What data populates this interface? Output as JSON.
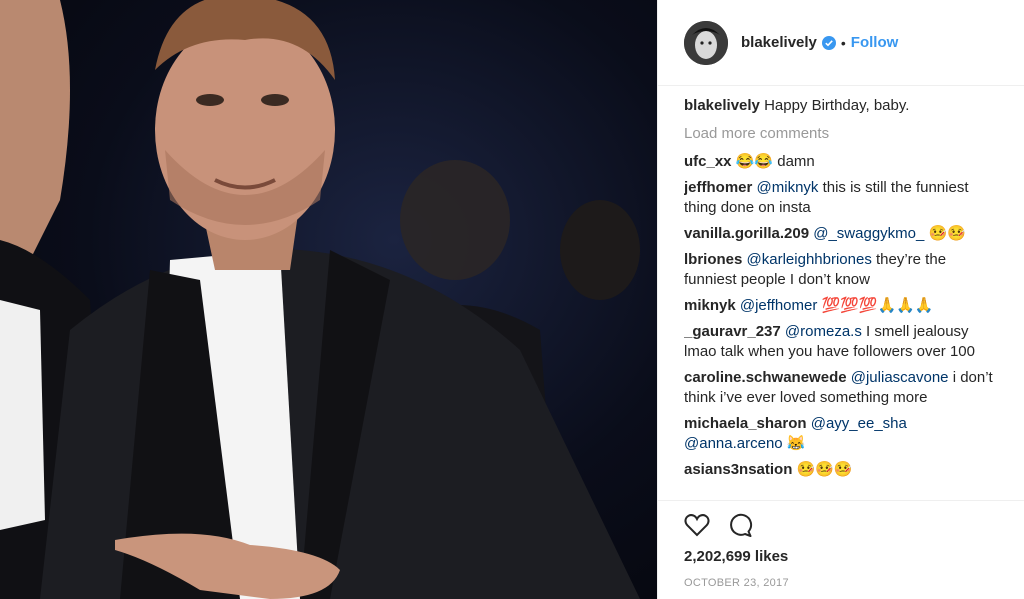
{
  "post": {
    "username": "blakelively",
    "verified": true,
    "separator": "•",
    "follow_label": "Follow",
    "caption_user": "blakelively",
    "caption_text": "Happy Birthday, baby.",
    "load_more": "Load more comments",
    "likes": "2,202,699 likes",
    "date": "OCTOBER 23, 2017"
  },
  "comments": [
    {
      "user": "ufc_xx",
      "parts": [
        {
          "t": "😂😂 damn",
          "m": false
        }
      ]
    },
    {
      "user": "jeffhomer",
      "parts": [
        {
          "t": "@miknyk",
          "m": true
        },
        {
          "t": " this is still the funniest thing done on insta",
          "m": false
        }
      ]
    },
    {
      "user": "vanilla.gorilla.209",
      "parts": [
        {
          "t": "@_swaggykmo_",
          "m": true
        },
        {
          "t": " 🤒🤒",
          "m": false
        }
      ]
    },
    {
      "user": "lbriones",
      "parts": [
        {
          "t": "@karleighhbriones",
          "m": true
        },
        {
          "t": " they’re the funniest people I don’t know",
          "m": false
        }
      ]
    },
    {
      "user": "miknyk",
      "parts": [
        {
          "t": "@jeffhomer",
          "m": true
        },
        {
          "t": " 💯💯💯🙏🙏🙏",
          "m": false
        }
      ]
    },
    {
      "user": "_gauravr_237",
      "parts": [
        {
          "t": "@romeza.s",
          "m": true
        },
        {
          "t": " I smell jealousy lmao talk when you have followers over 100",
          "m": false
        }
      ]
    },
    {
      "user": "caroline.schwanewede",
      "parts": [
        {
          "t": "@juliascavone",
          "m": true
        },
        {
          "t": " i don’t think i’ve ever loved something more",
          "m": false
        }
      ]
    },
    {
      "user": "michaela_sharon",
      "parts": [
        {
          "t": "@ayy_ee_sha",
          "m": true
        },
        {
          "t": " ",
          "m": false
        },
        {
          "t": "@anna.arceno",
          "m": true
        },
        {
          "t": " 😹",
          "m": false
        }
      ]
    },
    {
      "user": "asians3nsation",
      "parts": [
        {
          "t": " 🤒🤒🤒",
          "m": false
        }
      ]
    }
  ],
  "icons": [
    "heart-icon",
    "comment-icon"
  ],
  "colors": {
    "link": "#3897f0",
    "mention": "#003569",
    "muted": "#999999",
    "text": "#262626"
  }
}
